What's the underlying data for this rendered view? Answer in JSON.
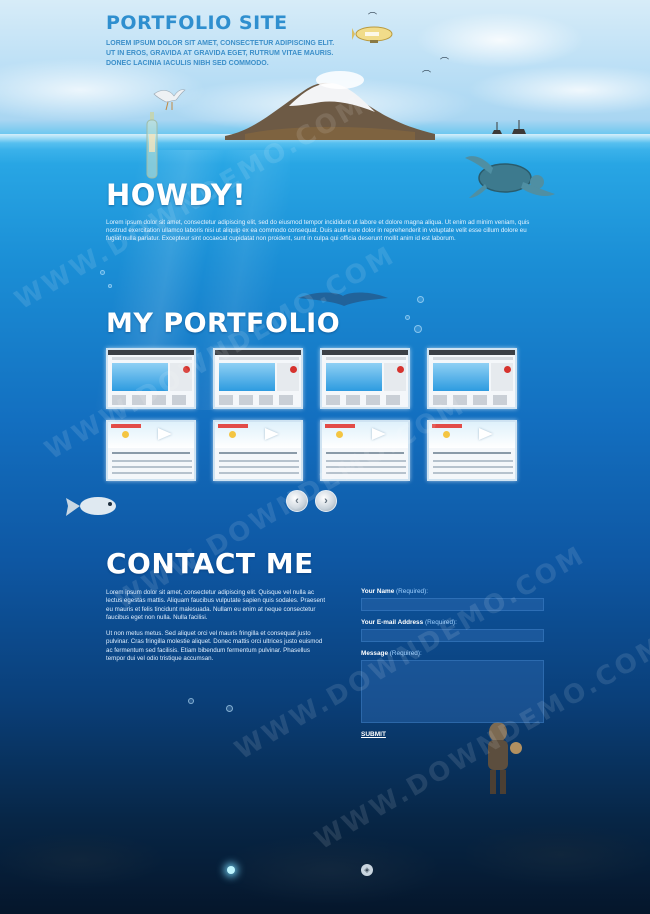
{
  "header": {
    "site_title": "PORTFOLIO SITE",
    "tagline": "LOREM IPSUM DOLOR SIT AMET, CONSECTETUR ADIPISCING ELIT. UT IN EROS, GRAVIDA AT GRAVIDA EGET, RUTRUM VITAE MAURIS. DONEC LACINIA IACULIS NIBH SED COMMODO."
  },
  "howdy": {
    "title": "HOWDY!",
    "text": "Lorem ipsum dolor sit amet, consectetur adipiscing elit, sed do eiusmod tempor incididunt ut labore et dolore magna aliqua. Ut enim ad minim veniam, quis nostrud exercitation ullamco laboris nisi ut aliquip ex ea commodo consequat. Duis aute irure dolor in reprehenderit in voluptate velit esse cillum dolore eu fugiat nulla pariatur. Excepteur sint occaecat cupidatat non proident, sunt in culpa qui officia deserunt mollit anim id est laborum."
  },
  "portfolio": {
    "title": "MY PORTFOLIO",
    "thumbnails": [
      {
        "style": "a"
      },
      {
        "style": "a"
      },
      {
        "style": "a"
      },
      {
        "style": "a"
      },
      {
        "style": "b"
      },
      {
        "style": "b"
      },
      {
        "style": "b"
      },
      {
        "style": "b"
      }
    ],
    "prev_icon": "‹",
    "next_icon": "›"
  },
  "contact": {
    "title": "CONTACT ME",
    "paragraph_1": "Lorem ipsum dolor sit amet, consectetur adipiscing elit. Quisque vel nulla ac lectus egestas mattis. Aliquam faucibus vulputate sapien quis sodales. Praesent eu mauris et felis tincidunt malesuada. Nullam eu enim at neque consectetur faucibus eget non nulla. Nulla facilisi.",
    "paragraph_2": "Ut non metus metus. Sed aliquet orci vel mauris fringilla et consequat justo pulvinar. Cras fringilla molestie aliquet. Donec mattis orci ultrices justo euismod ac fermentum sed facilisis. Etiam bibendum fermentum pulvinar. Phasellus tempor dui vel odio tristique accumsan.",
    "form": {
      "name_label": "Your Name",
      "name_required": "(Required):",
      "email_label": "Your E-mail Address",
      "email_required": "(Required):",
      "message_label": "Message",
      "message_required": "(Required):",
      "submit_label": "SUBMIT"
    }
  },
  "watermark_text": "WWW.DOWNDEMO.COM",
  "colors": {
    "title_blue": "#2f8fcf",
    "sea_top": "#2aa9e6",
    "sea_bottom": "#05162b"
  }
}
